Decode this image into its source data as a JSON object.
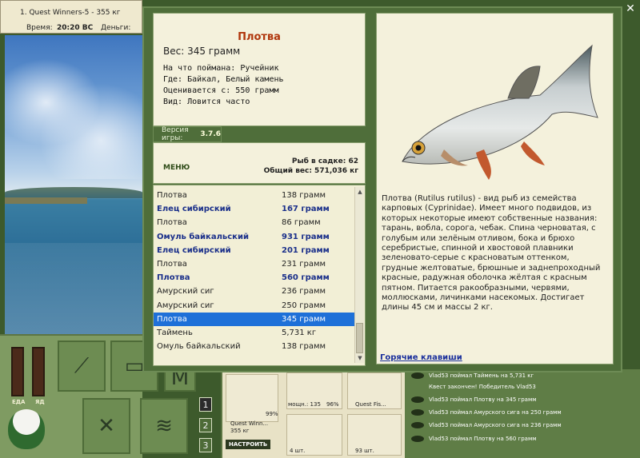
{
  "topbar": {
    "title": "1. Quest Winners-5 - 355 кг",
    "time_label": "Время:",
    "time_value": "20:20 ВС",
    "money_label": "Деньги:"
  },
  "dock": {
    "meter_left_label": "ЕДА",
    "meter_right_label": "ЯД",
    "tabs": [
      "1",
      "2",
      "3"
    ],
    "active_tab": "1"
  },
  "tackle": {
    "rig_name": "Quest Winn...",
    "rig_weight": "355 кг",
    "rig_percent": "99%",
    "setup_button": "НАСТРОИТЬ",
    "reel_label": "мощн.: 135",
    "reel_percent": "96%",
    "line_label": "Quest Fis...",
    "hook_count": "4 шт.",
    "bait_count": "93 шт."
  },
  "log": [
    "Vlad53 поймал Таймень на 5,731 кг",
    "Квест закончен! Победитель Vlad53",
    "Vlad53 поймал Плотву на 345 грамм",
    "Vlad53 поймал Амурского сига на 250 грамм",
    "Vlad53 поймал Амурского сига на 236 грамм",
    "Vlad53 поймал Плотву на 560 грамм"
  ],
  "fish_info": {
    "name": "Плотва",
    "weight": "Вес: 345 грамм",
    "bait": "На что поймана: Ручейник",
    "location": "Где: Байкал, Белый камень",
    "value": "Оценивается с: 550 грамм",
    "kind": "Вид: Ловится часто"
  },
  "version": {
    "label": "Версия игры:",
    "value": "3.7.6"
  },
  "stats": {
    "menu": "МЕНЮ",
    "catch_count": "Рыб в садке: 62",
    "total_weight": "Общий вес: 571,036 кг"
  },
  "catch_list": [
    {
      "name": "Плотва",
      "weight": "138 грамм",
      "bold": false
    },
    {
      "name": "Елец сибирский",
      "weight": "167 грамм",
      "bold": true
    },
    {
      "name": "Плотва",
      "weight": "86 грамм",
      "bold": false
    },
    {
      "name": "Омуль байкальский",
      "weight": "931 грамм",
      "bold": true
    },
    {
      "name": "Елец сибирский",
      "weight": "201 грамм",
      "bold": true
    },
    {
      "name": "Плотва",
      "weight": "231 грамм",
      "bold": false
    },
    {
      "name": "Плотва",
      "weight": "560 грамм",
      "bold": true
    },
    {
      "name": "Амурский сиг",
      "weight": "236 грамм",
      "bold": false
    },
    {
      "name": "Амурский сиг",
      "weight": "250 грамм",
      "bold": false
    },
    {
      "name": "Плотва",
      "weight": "345 грамм",
      "bold": false,
      "selected": true
    },
    {
      "name": "Таймень",
      "weight": "5,731 кг",
      "bold": false
    },
    {
      "name": "Омуль байкальский",
      "weight": "138 грамм",
      "bold": false
    }
  ],
  "description": "Плотва (Rutilus rutilus) - вид рыб из семейства карповых (Cyprinidae). Имеет много подвидов, из которых некоторые имеют собственные названия: тарань, вобла, сорога, чебак. Спина черноватая, с голубым или зелёным отливом, бока и брюхо серебристые, спинной и хвостовой плавники зеленовато-серые с красноватым оттенком, грудные желтоватые, брюшные и заднепроходный красные, радужная оболочка жёлтая с красным пятном. Питается ракообразными, червями, моллюсками, личинками насекомых. Достигает длины 45 см и массы 2 кг.",
  "hotkeys_link": "Горячие клавиши",
  "close_icon": "close-icon",
  "colors": {
    "frame": "#4f6e3a",
    "card": "#f4f1dc",
    "fish_name": "#b0360c",
    "highlight_text": "#1a2f8a",
    "selected_row": "#1e70d8"
  }
}
